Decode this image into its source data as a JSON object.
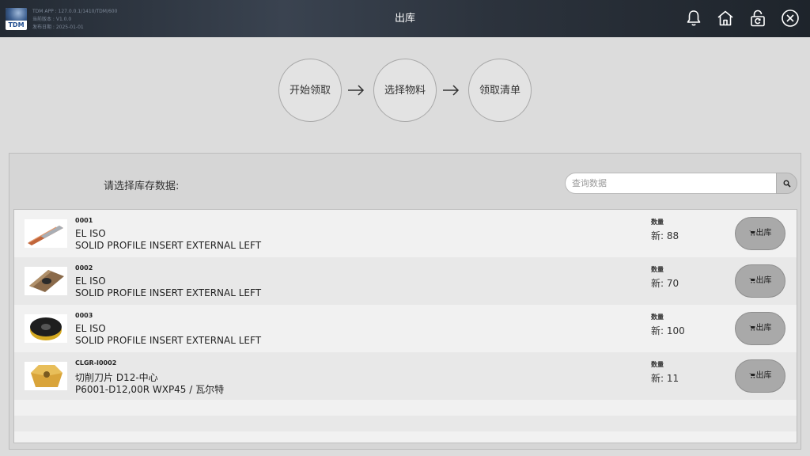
{
  "header": {
    "logo_text": "TDM",
    "app_info": [
      "TDM APP : 127.0.0.1/1410/TDM/600",
      "当前版本 : V1.0.0",
      "发布日期 : 2025-01-01"
    ],
    "title": "出库",
    "icons": [
      "bell-icon",
      "home-icon",
      "lock-refresh-icon",
      "close-icon"
    ]
  },
  "steps": [
    "开始领取",
    "选择物料",
    "领取清单"
  ],
  "panel": {
    "label": "请选择库存数据:",
    "search_placeholder": "查询数据"
  },
  "items": [
    {
      "code": "0001",
      "name": "EL ISO",
      "desc": "SOLID PROFILE INSERT EXTERNAL LEFT",
      "qty_label": "数量",
      "qty": "新: 88",
      "button": "出库",
      "thumb": "drill-bit-image"
    },
    {
      "code": "0002",
      "name": "EL ISO",
      "desc": "SOLID PROFILE INSERT EXTERNAL LEFT",
      "qty_label": "数量",
      "qty": "新: 70",
      "button": "出库",
      "thumb": "diamond-insert-image"
    },
    {
      "code": "0003",
      "name": "EL ISO",
      "desc": "SOLID PROFILE INSERT EXTERNAL LEFT",
      "qty_label": "数量",
      "qty": "新: 100",
      "button": "出库",
      "thumb": "round-insert-image"
    },
    {
      "code": "CLGR-I0002",
      "name": "切削刀片 D12-中心",
      "desc": "P6001-D12,00R WXP45 / 瓦尔特",
      "qty_label": "数量",
      "qty": "新: 11",
      "button": "出库",
      "thumb": "gold-insert-image"
    }
  ]
}
